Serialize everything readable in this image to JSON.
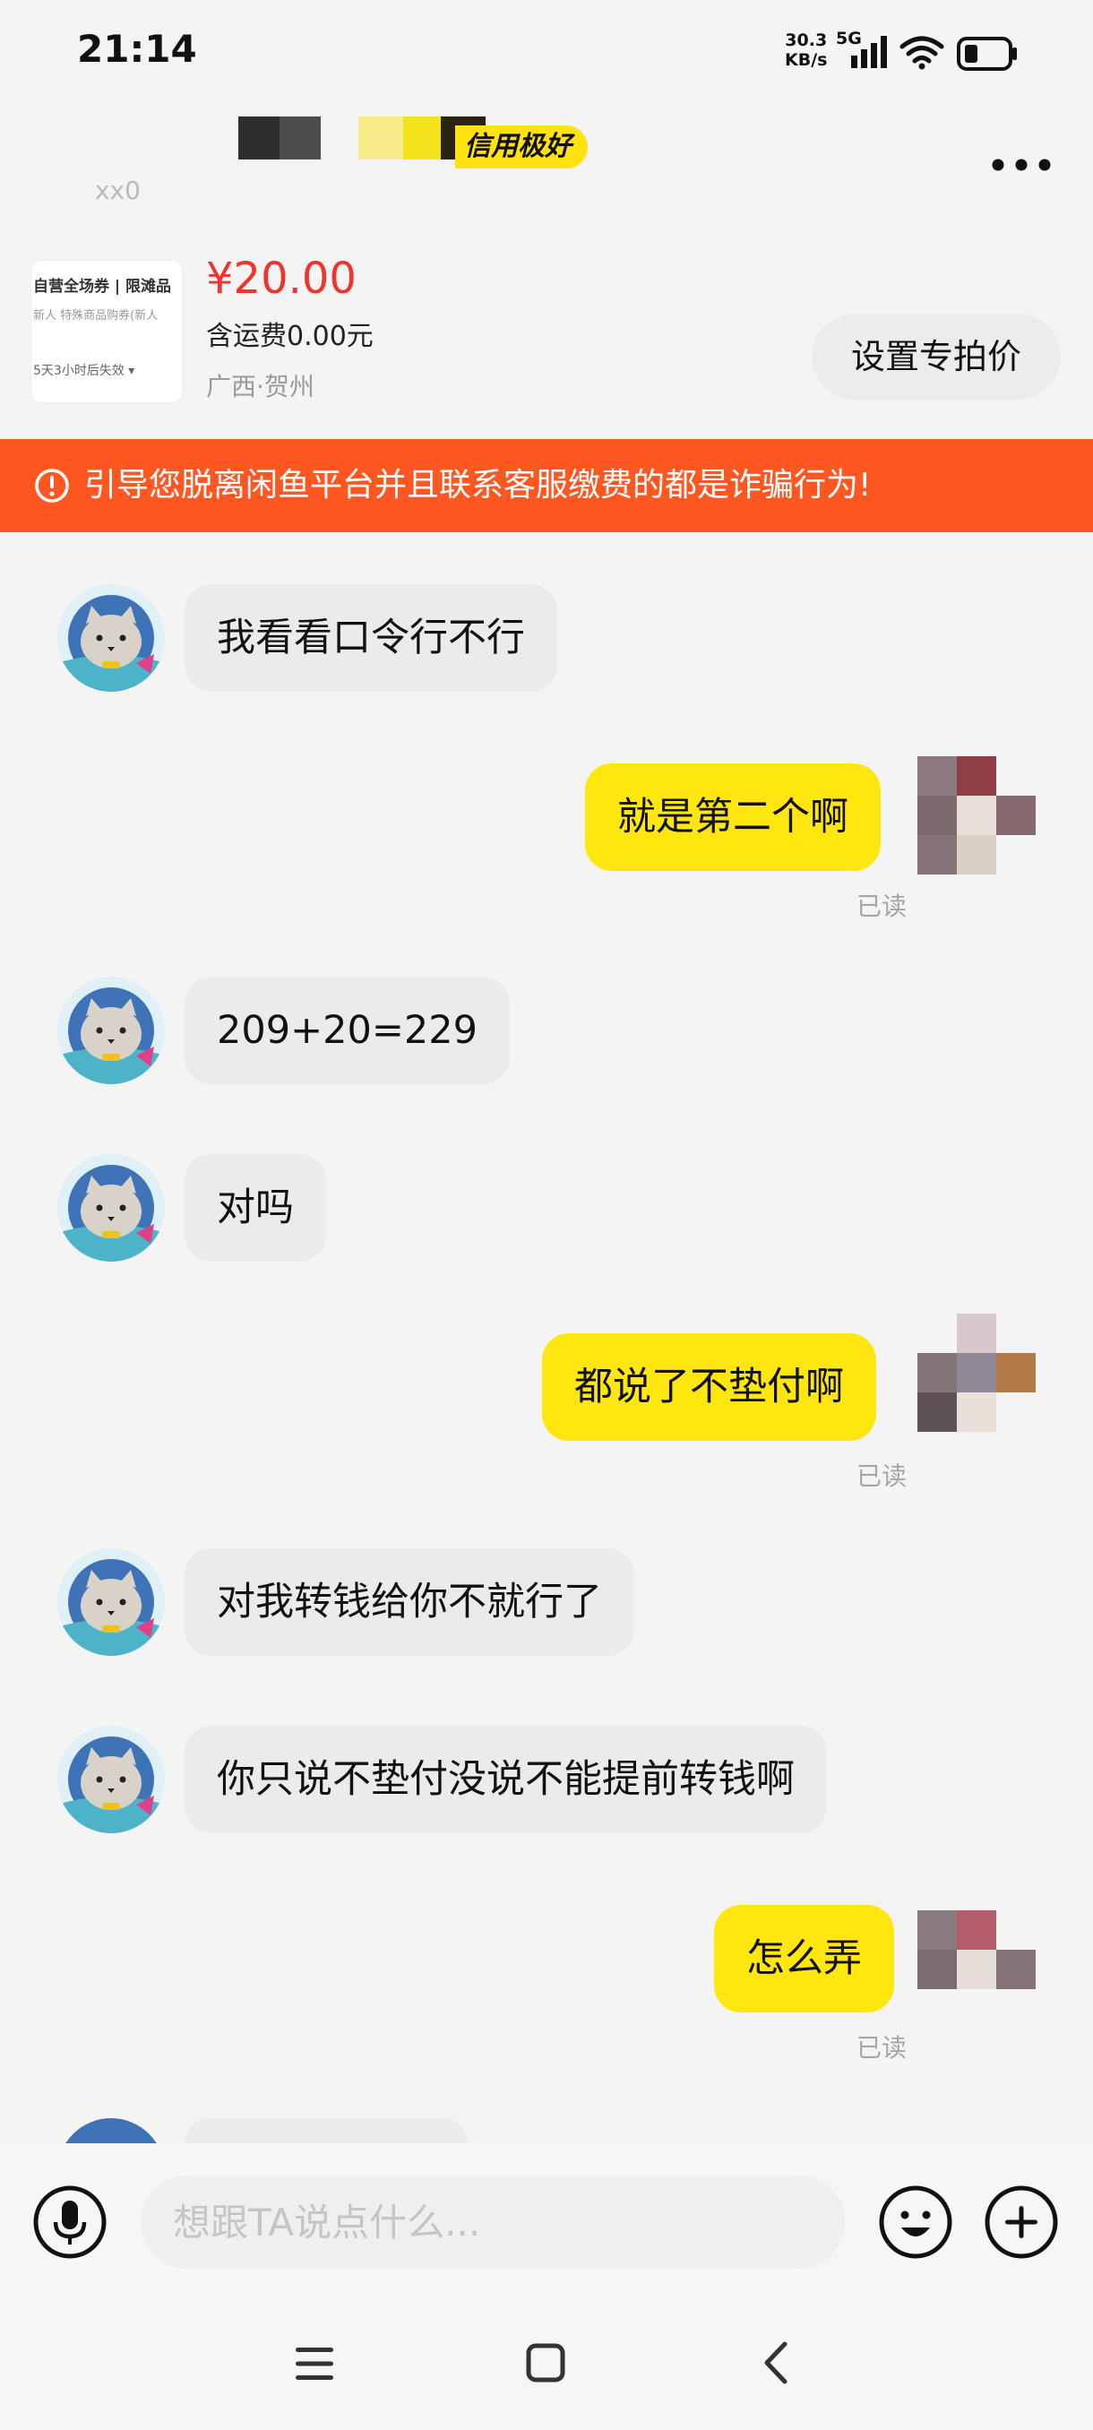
{
  "status_bar": {
    "time": "21:14",
    "net_speed_value": "30.3",
    "net_speed_unit": "KB/s",
    "network": "5G",
    "icons": [
      "signal-icon",
      "wifi-icon",
      "battery-icon"
    ]
  },
  "header": {
    "seller_badge": "信用极好",
    "faded_subtitle": "xx0",
    "more_icon": "more-dots-icon"
  },
  "product": {
    "thumb_line1": "自营全场券 | 限滩品",
    "thumb_line2": "新人 特殊商品购券(新人",
    "thumb_line3": "5天3小时后失效 ▾",
    "price": "¥20.00",
    "shipping": "含运费0.00元",
    "location": "广西·贺州",
    "set_price_button": "设置专拍价"
  },
  "warning": {
    "text": "引导您脱离闲鱼平台并且联系客服缴费的都是诈骗行为!",
    "icon": "alert-circle-icon"
  },
  "messages": [
    {
      "from": "other",
      "text": "我看看口令行不行"
    },
    {
      "from": "me",
      "text": "就是第二个啊",
      "status": "已读"
    },
    {
      "from": "other",
      "text": "209+20=229"
    },
    {
      "from": "other",
      "text": "对吗"
    },
    {
      "from": "me",
      "text": "都说了不垫付啊",
      "status": "已读"
    },
    {
      "from": "other",
      "text": "对我转钱给你不就行了"
    },
    {
      "from": "other",
      "text": "你只说不垫付没说不能提前转钱啊"
    },
    {
      "from": "me",
      "text": "怎么弄",
      "status": "已读"
    }
  ],
  "input_bar": {
    "placeholder": "想跟TA说点什么...",
    "icons": [
      "mic-icon",
      "emoji-icon",
      "plus-icon"
    ]
  },
  "nav_bar": {
    "icons": [
      "menu-icon",
      "home-square-icon",
      "back-chevron-icon"
    ]
  },
  "colors": {
    "accent_yellow": "#ffe60f",
    "warning_orange": "#ff5722",
    "price_red": "#f0342b",
    "incoming_bubble": "#ebebeb",
    "background": "#f4f4f4"
  }
}
